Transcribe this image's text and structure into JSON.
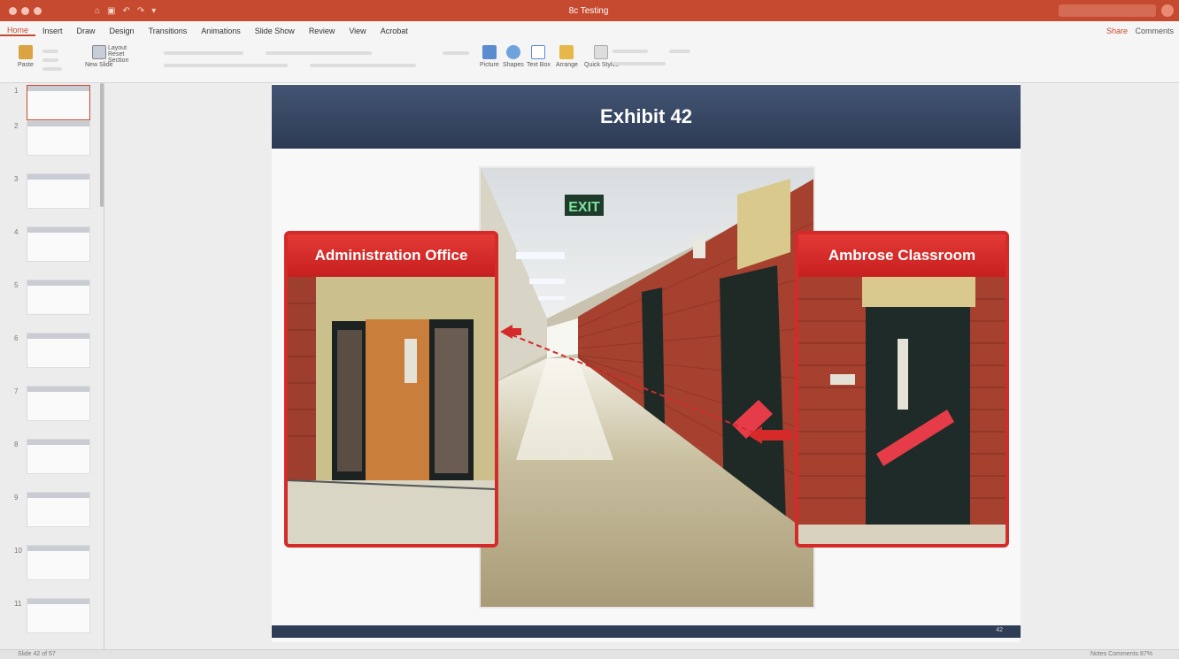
{
  "window": {
    "title": "8c Testing",
    "accent": "#c64a2f"
  },
  "menu": {
    "tabs": [
      "Home",
      "Insert",
      "Draw",
      "Design",
      "Transitions",
      "Animations",
      "Slide Show",
      "Review",
      "View",
      "Acrobat"
    ],
    "share_label": "Share",
    "comments_label": "Comments"
  },
  "ribbon": {
    "paste_label": "Paste",
    "new_slide_label": "New Slide",
    "layout_label": "Layout",
    "reset_label": "Reset",
    "section_label": "Section",
    "picture_label": "Picture",
    "shapes_label": "Shapes",
    "textbox_label": "Text Box",
    "arrange_label": "Arrange",
    "quick_styles_label": "Quick Styles"
  },
  "thumbnails": {
    "numbers": [
      "1",
      "2",
      "3",
      "4",
      "5",
      "6",
      "7",
      "8",
      "9",
      "10",
      "11"
    ]
  },
  "slide": {
    "title": "Exhibit 42",
    "left_callout_label": "Administration Office",
    "right_callout_label": "Ambrose Classroom",
    "exit_sign": "EXIT",
    "slide_number": "42",
    "header_color": "#2f3d56",
    "callout_color": "#d42a2a"
  },
  "status": {
    "slide_info": "Slide 42 of 57",
    "view_info": "Notes  Comments",
    "zoom": "87%"
  }
}
